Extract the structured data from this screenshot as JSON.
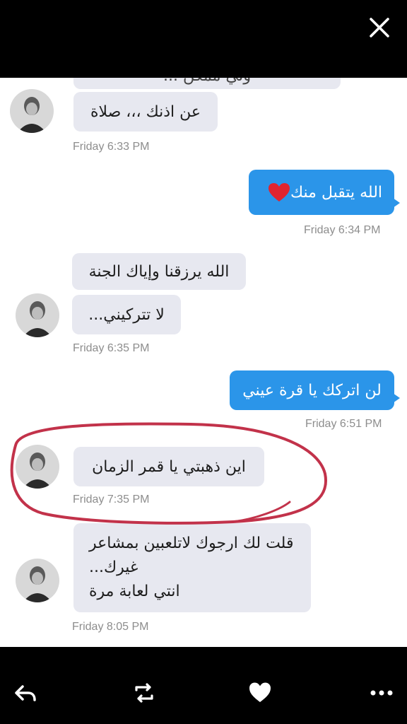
{
  "viewer": {
    "close_icon": "close-icon"
  },
  "messages": [
    {
      "id": "m0",
      "side": "in",
      "text": "ولي ممكن ..."
    },
    {
      "id": "m1",
      "side": "in",
      "text": "عن اذنك ،،، صلاة",
      "time": "Friday 6:33 PM"
    },
    {
      "id": "m2",
      "side": "out",
      "text": "الله يتقبل منك",
      "emoji": "heart",
      "time": "Friday 6:34 PM"
    },
    {
      "id": "m3",
      "side": "in",
      "text": "الله يرزقنا وإياك الجنة"
    },
    {
      "id": "m4",
      "side": "in",
      "text": "لا تتركيني...",
      "time": "Friday 6:35 PM"
    },
    {
      "id": "m5",
      "side": "out",
      "text": "لن اتركك يا قرة عيني",
      "time": "Friday 6:51 PM"
    },
    {
      "id": "m6",
      "side": "in",
      "text": "اين ذهبتي يا قمر الزمان",
      "time": "Friday 7:35 PM",
      "highlighted": true
    },
    {
      "id": "m7",
      "side": "in",
      "lines": [
        "قلت لك ارجوك لاتلعبين بمشاعر",
        "غيرك...",
        "انتي لعابة مرة"
      ],
      "time": "Friday 8:05 PM"
    }
  ],
  "times": {
    "t1": "Friday 6:33 PM",
    "t2": "Friday 6:34 PM",
    "t3": "Friday 6:35 PM",
    "t4": "Friday 6:51 PM",
    "t5": "Friday 7:35 PM",
    "t6": "Friday 8:05 PM"
  },
  "colors": {
    "outgoing": "#2b95e9",
    "incoming": "#e7e8f0",
    "annotation": "#c2324a"
  },
  "actions": [
    "reply-icon",
    "retweet-icon",
    "like-icon",
    "more-icon"
  ]
}
